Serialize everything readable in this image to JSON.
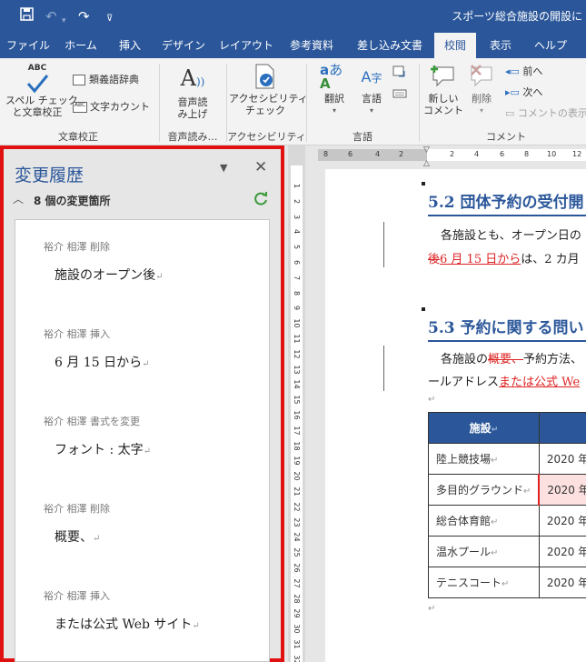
{
  "titlebar": {
    "doc_title": "スポーツ総合施設の開設に"
  },
  "tabs": [
    "ファイル",
    "ホーム",
    "挿入",
    "デザイン",
    "レイアウト",
    "参考資料",
    "差し込み文書",
    "校閲",
    "表示",
    "ヘルプ"
  ],
  "active_tab": "校閲",
  "ribbon": {
    "spell_check": [
      "スペル チェック",
      "と文章校正"
    ],
    "thesaurus": "類義語辞典",
    "word_count": "文字カウント",
    "group_proofing": "文章校正",
    "read_aloud": [
      "音声読",
      "み上げ"
    ],
    "group_speech": "音声読み…",
    "accessibility": [
      "アクセシビリティ",
      "チェック"
    ],
    "group_accessibility": "アクセシビリティ",
    "translate": "翻訳",
    "language": "言語",
    "group_language": "言語",
    "new_comment": [
      "新しい",
      "コメント"
    ],
    "delete": "削除",
    "previous": "前へ",
    "next": "次へ",
    "show_comments": "コメントの表示",
    "group_comments": "コメント"
  },
  "pane": {
    "title": "変更履歴",
    "count_label": "8 個の変更箇所",
    "revisions": [
      {
        "meta": "裕介 相澤 削除",
        "text": "施設のオープン後"
      },
      {
        "meta": "裕介 相澤 挿入",
        "text": "6 月 15 日から"
      },
      {
        "meta": "裕介 相澤 書式を変更",
        "text": "フォント : 太字"
      },
      {
        "meta": "裕介 相澤 削除",
        "text": "概要、"
      },
      {
        "meta": "裕介 相澤 挿入",
        "text": "または公式 Web サイト"
      }
    ]
  },
  "ruler": {
    "h": [
      "8",
      "6",
      "4",
      "2",
      "2",
      "4",
      "6",
      "8",
      "10",
      "12"
    ],
    "v": [
      "1",
      "2",
      "3",
      "4",
      "5",
      "6",
      "7",
      "8",
      "9",
      "10",
      "11",
      "12",
      "13",
      "14",
      "15",
      "16",
      "17",
      "18",
      "19",
      "20",
      "21",
      "22",
      "23",
      "24",
      "25",
      "26",
      "27",
      "28",
      "29",
      "30",
      "31",
      "32",
      "33"
    ]
  },
  "document": {
    "h52": "5.2  団体予約の受付開",
    "p52_line1": "各施設とも、オープン日の",
    "p52_del": "後",
    "p52_ins": "6 月 15 日から",
    "p52_rest": "は、2 カ月",
    "h53": "5.3  予約に関する問い",
    "p53_pre": "各施設の",
    "p53_del": "概要、",
    "p53_rest": "予約方法、",
    "p53_line2_pre": "ールアドレス",
    "p53_line2_ins": "または公式 We",
    "table_header": "施設",
    "table_rows": [
      {
        "name": "陸上競技場",
        "date": "2020 年"
      },
      {
        "name": "多目的グラウンド",
        "date": "2020 年"
      },
      {
        "name": "総合体育館",
        "date": "2020 年"
      },
      {
        "name": "温水プール",
        "date": "2020 年"
      },
      {
        "name": "テニスコート",
        "date": "2020 年"
      }
    ]
  },
  "colors": {
    "accent": "#2b579a",
    "revision": "#d22222",
    "highlight_border": "#e11111"
  }
}
